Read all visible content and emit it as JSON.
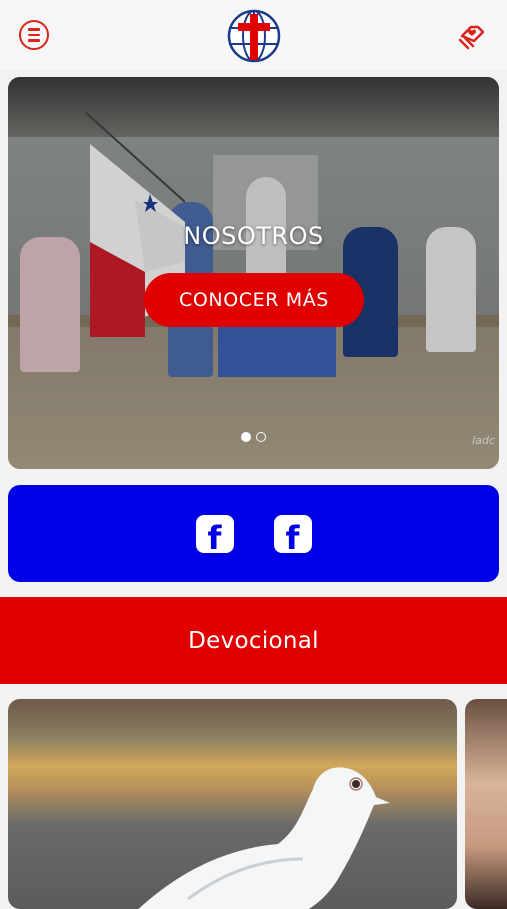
{
  "header": {
    "menu_icon": "menu-icon",
    "logo_icon": "cross-globe-logo",
    "donate_icon": "hand-heart-icon"
  },
  "hero": {
    "title": "NOSOTROS",
    "cta_label": "CONOCER MÁS",
    "watermark": "ladc",
    "slides": 2,
    "active_slide": 1
  },
  "social": {
    "buttons": [
      {
        "icon": "facebook-icon",
        "glyph": "f"
      },
      {
        "icon": "facebook-icon",
        "glyph": "f"
      }
    ]
  },
  "devocional": {
    "label": "Devocional"
  },
  "colors": {
    "accent_red": "#e00000",
    "social_blue": "#0000e6",
    "background": "#f2f2f2"
  }
}
